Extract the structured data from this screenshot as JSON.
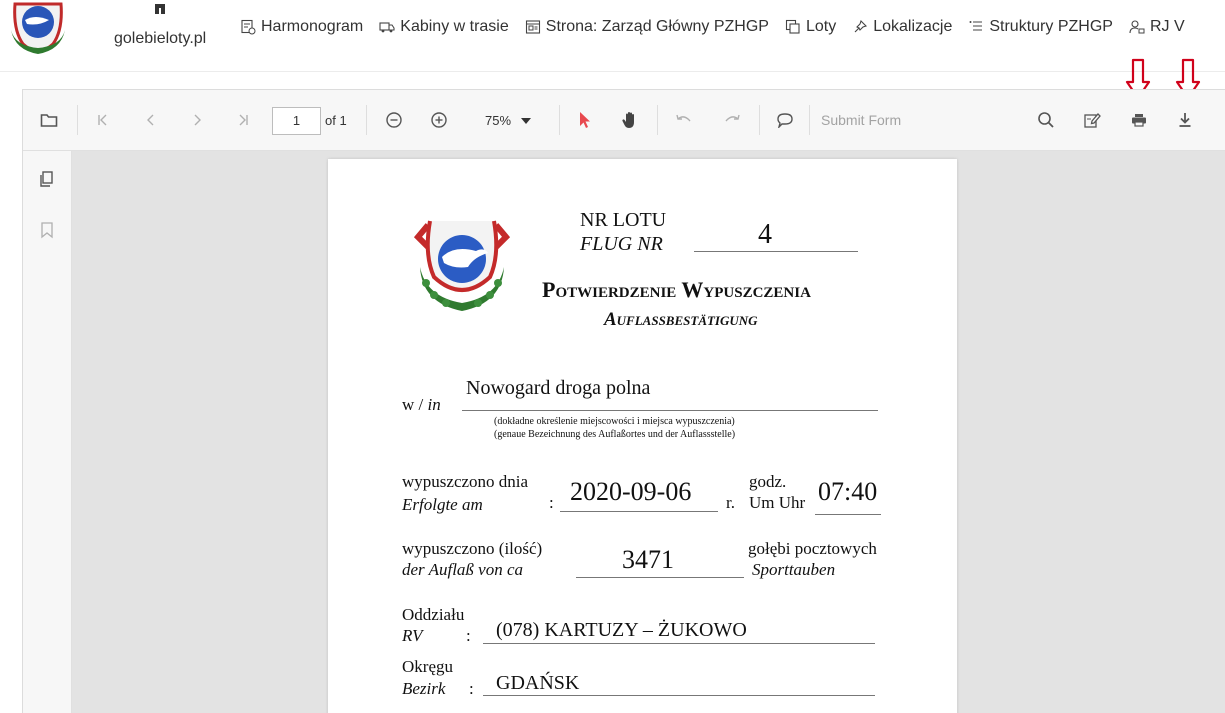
{
  "site": {
    "name": "golebieloty.pl",
    "nav": [
      {
        "label": "Harmonogram",
        "icon": "calendar-list-icon"
      },
      {
        "label": "Kabiny w trasie",
        "icon": "truck-icon"
      },
      {
        "label": "Strona: Zarząd Główny PZHGP",
        "icon": "page-icon"
      },
      {
        "label": "Loty",
        "icon": "copy-icon"
      },
      {
        "label": "Lokalizacje",
        "icon": "pin-icon"
      },
      {
        "label": "Struktury PZHGP",
        "icon": "list-icon"
      },
      {
        "label": "RJ V",
        "icon": "user-lock-icon"
      }
    ]
  },
  "viewer": {
    "page_number": "1",
    "page_of": "of 1",
    "zoom": "75%",
    "submit_form": "Submit Form"
  },
  "document": {
    "nr_lotu_pl": "NR LOTU",
    "nr_lotu_de": "FLUG NR",
    "nr_lotu_value": "4",
    "title_pl": "Potwierdzenie Wypuszczenia",
    "title_de": "Auflaßbestätigung",
    "place_label": "w / ",
    "place_label_de": "in",
    "place_value": "Nowogard droga polna",
    "place_note_pl": "(dokładne określenie miejscowości i miejsca wypuszczenia)",
    "place_note_de": "(genaue Bezeichnung des Auflaßortes und der Auflassstelle)",
    "date_label_pl": "wypuszczono dnia",
    "date_label_de": "Erfolgte am",
    "colon": ":",
    "date_value": "2020-09-06",
    "date_suffix": "r.",
    "time_label_pl": "godz.",
    "time_label_de": "Um Uhr",
    "time_value": "07:40",
    "count_label_pl": "wypuszczono (ilość)",
    "count_label_de": "der Auflaß von ca",
    "count_value": "3471",
    "count_unit_pl": "gołębi pocztowych",
    "count_unit_de": "Sporttauben",
    "branch_label_pl": "Oddziału",
    "branch_label_de": "RV",
    "branch_value": "(078) KARTUZY – ŻUKOWO",
    "district_label_pl": "Okręgu",
    "district_label_de": "Bezirk",
    "district_value": "GDAŃSK"
  },
  "colors": {
    "annotation_arrow": "#d0021b",
    "select_tool": "#e8494f"
  }
}
